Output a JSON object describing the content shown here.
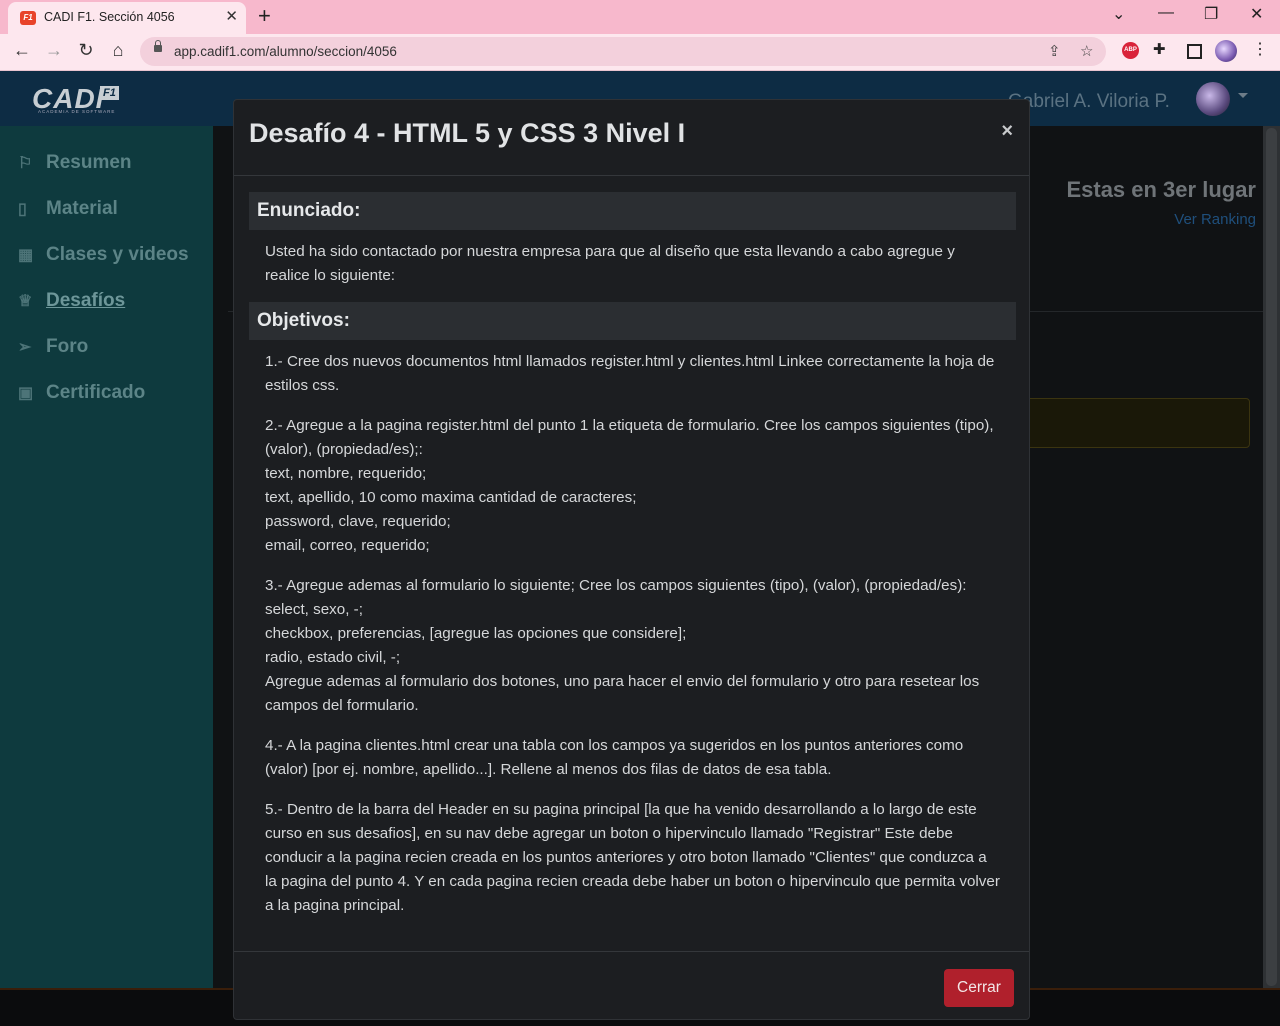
{
  "browser": {
    "tab_title": "CADI F1. Sección 4056",
    "tab_favicon": "F1",
    "url": "app.cadif1.com/alumno/seccion/4056"
  },
  "header": {
    "logo_text": "CADI",
    "logo_badge": "F1",
    "logo_sub": "ACADEMIA DE SOFTWARE",
    "user_name": "Gabriel A. Viloria P."
  },
  "sidebar": {
    "items": [
      {
        "label": "Resumen",
        "icon": "flag-icon"
      },
      {
        "label": "Material",
        "icon": "book-icon"
      },
      {
        "label": "Clases y videos",
        "icon": "calendar-icon"
      },
      {
        "label": "Desafíos",
        "icon": "trophy-icon"
      },
      {
        "label": "Foro",
        "icon": "send-icon"
      },
      {
        "label": "Certificado",
        "icon": "certificate-icon"
      }
    ]
  },
  "main": {
    "ranking_title": "Estas en 3er lugar",
    "ranking_link": "Ver Ranking"
  },
  "modal": {
    "title": "Desafío 4 - HTML 5 y CSS 3 Nivel I",
    "close_label": "×",
    "enunciado_head": "Enunciado:",
    "enunciado_text": "Usted ha sido contactado por nuestra empresa para que al diseño que esta llevando a cabo agregue y realice lo siguiente:",
    "objetivos_head": "Objetivos:",
    "objetivos": [
      "1.- Cree dos nuevos documentos html llamados register.html y clientes.html Linkee correctamente la hoja de estilos css.",
      "2.- Agregue a la pagina register.html del punto 1 la etiqueta de formulario. Cree los campos siguientes (tipo), (valor), (propiedad/es);:\ntext, nombre, requerido;\ntext, apellido, 10 como maxima cantidad de caracteres;\npassword, clave, requerido;\nemail, correo, requerido;",
      "3.- Agregue ademas al formulario lo siguiente; Cree los campos siguientes (tipo), (valor), (propiedad/es):\nselect, sexo, -;\ncheckbox, preferencias, [agregue las opciones que considere];\nradio, estado civil, -;\nAgregue ademas al formulario dos botones, uno para hacer el envio del formulario y otro para resetear los campos del formulario.",
      "4.- A la pagina clientes.html crear una tabla con los campos ya sugeridos en los puntos anteriores como (valor) [por ej. nombre, apellido...]. Rellene al menos dos filas de datos de esa tabla.",
      "5.- Dentro de la barra del Header en su pagina principal [la que ha venido desarrollando a lo largo de este curso en sus desafios], en su nav debe agregar un boton o hipervinculo llamado \"Registrar\" Este debe conducir a la pagina recien creada en los puntos anteriores y otro boton llamado \"Clientes\" que conduzca a la pagina del punto 4. Y en cada pagina recien creada debe haber un boton o hipervinculo que permita volver a la pagina principal."
    ],
    "footer_button": "Cerrar"
  }
}
